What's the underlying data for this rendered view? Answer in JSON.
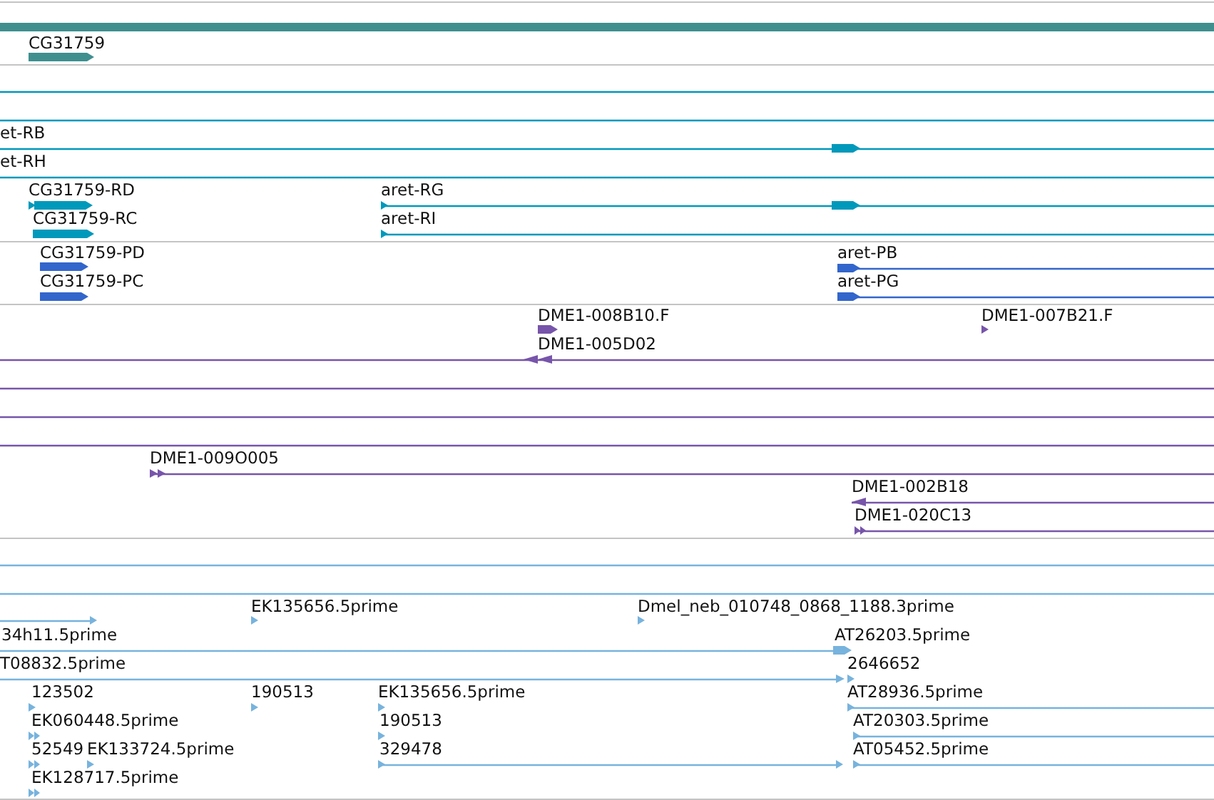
{
  "tracks": [
    {
      "kind": "gene",
      "color": "#3f8f8f",
      "labels": [
        "CG31759"
      ]
    },
    {
      "kind": "transcript",
      "color": "#0099bb",
      "labels": [
        "et-RB",
        "et-RH",
        "CG31759-RD",
        "aret-RG",
        "CG31759-RC",
        "aret-RI"
      ]
    },
    {
      "kind": "protein",
      "color": "#3366cc",
      "labels": [
        "CG31759-PD",
        "aret-PB",
        "CG31759-PC",
        "aret-PG"
      ]
    },
    {
      "kind": "clone",
      "color": "#7755aa",
      "labels": [
        "DME1-008B10.F",
        "DME1-007B21.F",
        "DME1-005D02",
        "DME1-009O005",
        "DME1-002B18",
        "DME1-020C13"
      ]
    },
    {
      "kind": "est",
      "color": "#77b3dd",
      "labels": [
        "EK135656.5prime",
        "Dmel_neb_010748_0868_1188.3prime",
        "34h11.5prime",
        "AT26203.5prime",
        "T08832.5prime",
        "2646652",
        "123502",
        "190513",
        "EK135656.5prime",
        "AT28936.5prime",
        "EK060448.5prime",
        "190513",
        "AT20303.5prime",
        "52549",
        "EK133724.5prime",
        "329478",
        "AT05452.5prime",
        "EK128717.5prime"
      ]
    }
  ]
}
